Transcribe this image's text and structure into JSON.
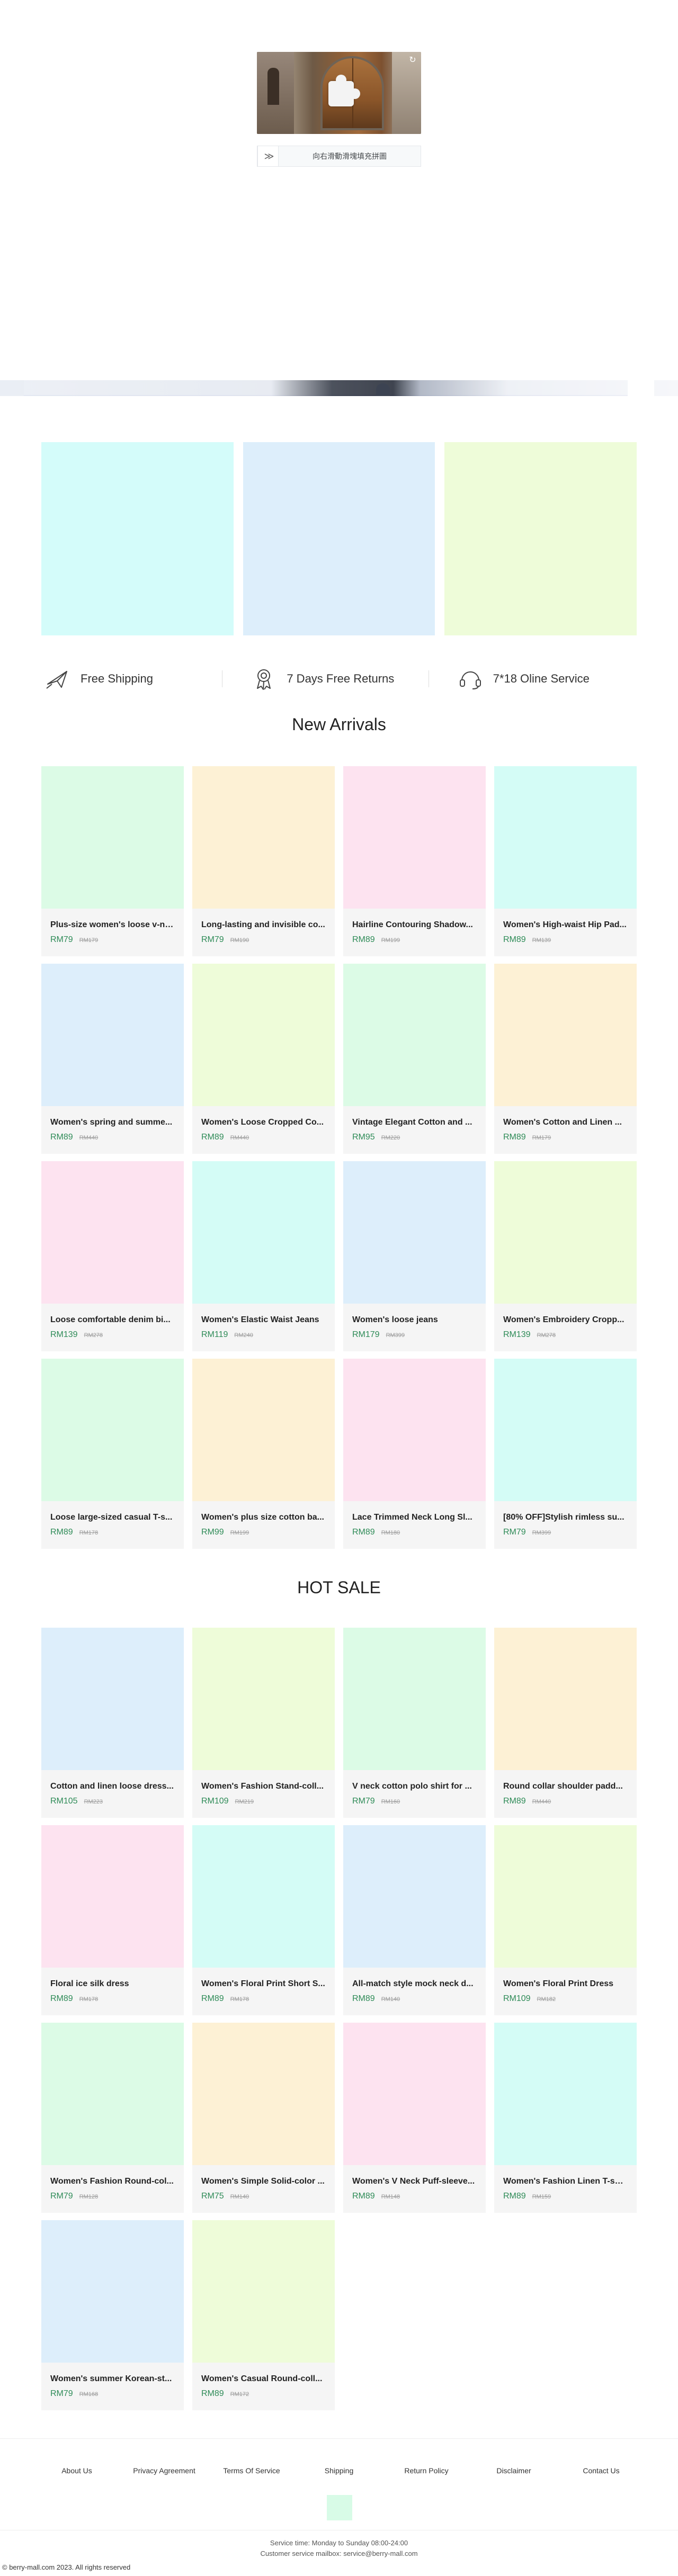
{
  "captcha": {
    "hint": "向右滑動滑塊填充拼圖",
    "handle_glyph": "≫",
    "refresh_glyph": "↻"
  },
  "banners": [
    {
      "color": "#d4fcfa"
    },
    {
      "color": "#ddeefb"
    },
    {
      "color": "#eefcd9"
    }
  ],
  "services": [
    {
      "icon": "plane-icon",
      "label": "Free Shipping"
    },
    {
      "icon": "badge-icon",
      "label": "7 Days Free Returns"
    },
    {
      "icon": "headset-icon",
      "label": "7*18 Oline Service"
    }
  ],
  "new_arrivals": {
    "title": "New Arrivals",
    "products": [
      {
        "name": "Plus-size women's loose v-neck...",
        "price": "RM79",
        "old": "RM179",
        "color": "#dcfbe6"
      },
      {
        "name": "Long-lasting and invisible co...",
        "price": "RM79",
        "old": "RM190",
        "color": "#fdf1d5"
      },
      {
        "name": "Hairline Contouring Shadow...",
        "price": "RM89",
        "old": "RM199",
        "color": "#fde3f0"
      },
      {
        "name": "Women's High-waist Hip Pad...",
        "price": "RM89",
        "old": "RM139",
        "color": "#d4fcf6"
      },
      {
        "name": "Women's spring and summe...",
        "price": "RM89",
        "old": "RM440",
        "color": "#ddeefb"
      },
      {
        "name": "Women's Loose Cropped Co...",
        "price": "RM89",
        "old": "RM440",
        "color": "#eefcd9"
      },
      {
        "name": "Vintage Elegant Cotton and ...",
        "price": "RM95",
        "old": "RM220",
        "color": "#dcfbe6"
      },
      {
        "name": "Women's Cotton and Linen ...",
        "price": "RM89",
        "old": "RM179",
        "color": "#fdf1d5"
      },
      {
        "name": "Loose comfortable denim bi...",
        "price": "RM139",
        "old": "RM278",
        "color": "#fde3f0"
      },
      {
        "name": "Women's Elastic Waist Jeans",
        "price": "RM119",
        "old": "RM240",
        "color": "#d4fcf6"
      },
      {
        "name": "Women's loose jeans",
        "price": "RM179",
        "old": "RM399",
        "color": "#ddeefb"
      },
      {
        "name": "Women's Embroidery Cropp...",
        "price": "RM139",
        "old": "RM278",
        "color": "#eefcd9"
      },
      {
        "name": "Loose large-sized casual T-s...",
        "price": "RM89",
        "old": "RM178",
        "color": "#dcfbe6"
      },
      {
        "name": "Women's plus size cotton ba...",
        "price": "RM99",
        "old": "RM199",
        "color": "#fdf1d5"
      },
      {
        "name": "Lace Trimmed Neck Long Sl...",
        "price": "RM89",
        "old": "RM180",
        "color": "#fde3f0"
      },
      {
        "name": "[80% OFF]Stylish rimless su...",
        "price": "RM79",
        "old": "RM399",
        "color": "#d4fcf6"
      }
    ]
  },
  "hot_sale": {
    "title": "HOT SALE",
    "products": [
      {
        "name": "Cotton and linen loose dress...",
        "price": "RM105",
        "old": "RM223",
        "color": "#ddeefb"
      },
      {
        "name": "Women's Fashion Stand-coll...",
        "price": "RM109",
        "old": "RM219",
        "color": "#eefcd9"
      },
      {
        "name": "V neck cotton polo shirt for ...",
        "price": "RM79",
        "old": "RM160",
        "color": "#dcfbe6"
      },
      {
        "name": "Round collar shoulder padd...",
        "price": "RM89",
        "old": "RM440",
        "color": "#fdf1d5"
      },
      {
        "name": "Floral ice silk dress",
        "price": "RM89",
        "old": "RM178",
        "color": "#fde3f0"
      },
      {
        "name": "Women's Floral Print Short S...",
        "price": "RM89",
        "old": "RM178",
        "color": "#d4fcf6"
      },
      {
        "name": "All-match style mock neck d...",
        "price": "RM89",
        "old": "RM140",
        "color": "#ddeefb"
      },
      {
        "name": "Women's Floral Print Dress",
        "price": "RM109",
        "old": "RM182",
        "color": "#eefcd9"
      },
      {
        "name": "Women's Fashion Round-col...",
        "price": "RM79",
        "old": "RM128",
        "color": "#dcfbe6"
      },
      {
        "name": "Women's Simple Solid-color ...",
        "price": "RM75",
        "old": "RM140",
        "color": "#fdf1d5"
      },
      {
        "name": "Women's V Neck Puff-sleeve...",
        "price": "RM89",
        "old": "RM148",
        "color": "#fde3f0"
      },
      {
        "name": "Women's Fashion Linen T-shirt",
        "price": "RM89",
        "old": "RM159",
        "color": "#d4fcf6"
      },
      {
        "name": "Women's summer Korean-st...",
        "price": "RM79",
        "old": "RM168",
        "color": "#ddeefb"
      },
      {
        "name": "Women's Casual Round-coll...",
        "price": "RM89",
        "old": "RM172",
        "color": "#eefcd9"
      }
    ]
  },
  "footer": {
    "links": [
      "About Us",
      "Privacy Agreement",
      "Terms Of Service",
      "Shipping",
      "Return Policy",
      "Disclaimer",
      "Contact Us"
    ],
    "service_time": "Service time: Monday to Sunday 08:00-24:00",
    "mailbox": "Customer service mailbox: service@berry-mall.com",
    "copyright": "© berry-mall.com 2023. All rights reserved"
  }
}
